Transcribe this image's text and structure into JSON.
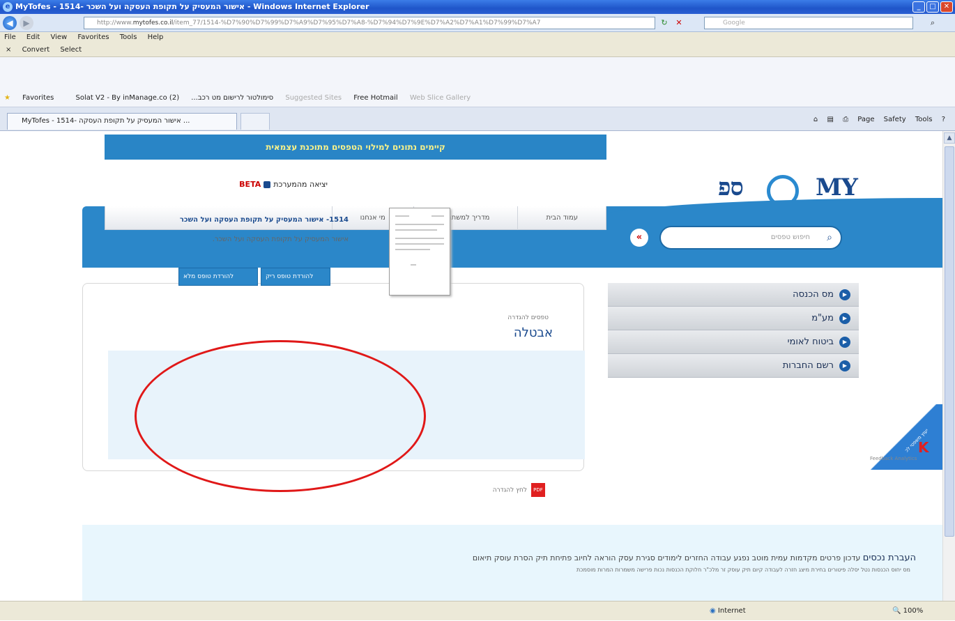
{
  "window": {
    "title": "MyTofes - 1514- אישור המעסיק על תקופת העסקה ועל השכר - Windows Internet Explorer"
  },
  "address": {
    "url_prefix": "http://www.",
    "url_host": "mytofes.co.il",
    "url_rest": "/item_77/1514-%D7%90%D7%99%D7%A9%D7%95%D7%A8-%D7%94%D7%9E%D7%A2%D7%A1%D7%99%D7%A7",
    "search_placeholder": "Google"
  },
  "menu": [
    "File",
    "Edit",
    "View",
    "Favorites",
    "Tools",
    "Help"
  ],
  "cmdbar2": {
    "convert": "Convert",
    "select": "Select"
  },
  "favorites": {
    "label": "Favorites",
    "items": [
      "Solat V2 - By inManage.co (2)",
      "...סימולטור לרישום מט רכב",
      "Suggested Sites",
      "Free Hotmail",
      "Web Slice Gallery"
    ]
  },
  "tab": {
    "title": "MyTofes - 1514- אישור המעסיק על תקופת העסקה ..."
  },
  "cmdright": [
    "Page",
    "Safety",
    "Tools"
  ],
  "page": {
    "banner": "קיימים נתונים למילוי הטפסים מתוכנת עצמאית",
    "logo_left": "MY",
    "logo_right": "ספ",
    "exit": "יציאה מהמערכת",
    "beta": "BETA",
    "nav": [
      "עמוד הבית",
      "מדריך למשתמש",
      "מי אנחנו"
    ],
    "search_placeholder": "חיפוש טפסים",
    "search_go": "«",
    "sidebar": [
      "מס הכנסה",
      "מע\"מ",
      "ביטוח לאומי",
      "רשם החברות"
    ],
    "card": {
      "category": "טפסים להגדרה",
      "title": "אבטלה",
      "form_name": "1514- אישור המעסיק על תקופת העסקה ועל השכר",
      "form_desc": "אישור המעסיק על תקופת העסקה ועל השכר.",
      "btn_empty": "להורדת טופס ריק",
      "btn_full": "להורדת טופס מלא"
    },
    "pdf_link": "לחץ להגדרה",
    "pdf_icon": "PDF",
    "footer_main": [
      "העברת נכסים",
      "עדכון פרטים",
      "מקדמות",
      "עמית מוטב",
      "נפגע עבודה",
      "החזרים",
      "לימודים",
      "סגירת עסק",
      "הוראה לחיוב",
      "פתיחת תיק",
      "הסרת עוסק",
      "תיאום"
    ],
    "footer_sub": "מס   יחוס הכנסות   נטל יסלה   פיטורים   בחירת מיצג   חזרה לעבודה   קיום תיק   עוסק זר   מלכ\"ר   חלוקת הכנסות   נכות   פרישה   משמרות   המרות מוסמכת",
    "corner_tag": "יעוץ משפטי לכ",
    "corner_k": "K",
    "feedback": "Feedback Analytics"
  },
  "status": {
    "zone": "Internet",
    "zoom": "100%"
  }
}
